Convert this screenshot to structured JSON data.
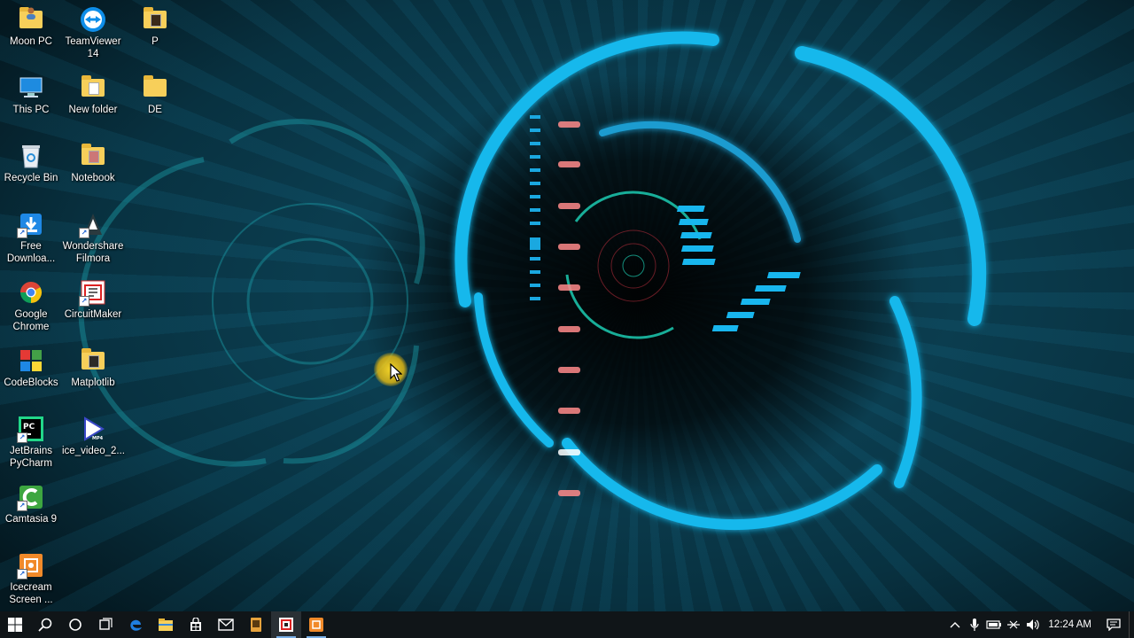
{
  "desktop": {
    "icons": [
      {
        "label": "Moon PC",
        "icon": "user-folder-icon"
      },
      {
        "label": "TeamViewer 14",
        "icon": "teamviewer-icon"
      },
      {
        "label": "P",
        "icon": "document-icon"
      },
      {
        "label": "This PC",
        "icon": "computer-icon"
      },
      {
        "label": "New folder",
        "icon": "folder-icon"
      },
      {
        "label": "DE",
        "icon": "folder-icon"
      },
      {
        "label": "Recycle Bin",
        "icon": "recycle-bin-icon"
      },
      {
        "label": "Notebook",
        "icon": "folder-icon"
      },
      {
        "label": "Free Downloa...",
        "icon": "download-manager-icon"
      },
      {
        "label": "Wondershare Filmora",
        "icon": "filmora-icon"
      },
      {
        "label": "Google Chrome",
        "icon": "chrome-icon"
      },
      {
        "label": "CircuitMaker",
        "icon": "circuitmaker-icon"
      },
      {
        "label": "CodeBlocks",
        "icon": "codeblocks-icon"
      },
      {
        "label": "Matplotlib",
        "icon": "document-icon"
      },
      {
        "label": "JetBrains PyCharm",
        "icon": "pycharm-icon"
      },
      {
        "label": "ice_video_2...",
        "icon": "mp4-video-icon"
      },
      {
        "label": "Camtasia 9",
        "icon": "camtasia-icon"
      },
      {
        "label": "Icecream Screen ...",
        "icon": "icecream-recorder-icon"
      }
    ]
  },
  "taskbar": {
    "buttons": [
      {
        "icon": "windows-start-icon"
      },
      {
        "icon": "search-icon"
      },
      {
        "icon": "cortana-icon"
      },
      {
        "icon": "task-view-icon"
      },
      {
        "icon": "edge-icon"
      },
      {
        "icon": "file-explorer-icon"
      },
      {
        "icon": "store-icon"
      },
      {
        "icon": "mail-icon"
      },
      {
        "icon": "video-editor-icon"
      },
      {
        "icon": "circuitmaker-icon"
      },
      {
        "icon": "icecream-recorder-icon"
      }
    ],
    "tray": {
      "icons": [
        "chevron-up-icon",
        "microphone-icon",
        "battery-icon",
        "network-icon",
        "volume-icon"
      ],
      "clock": "12:24 AM"
    }
  },
  "colors": {
    "accent_cyan": "#0fb4e6",
    "taskbar_bg": "#101518",
    "cursor_halo": "#f0c818"
  }
}
